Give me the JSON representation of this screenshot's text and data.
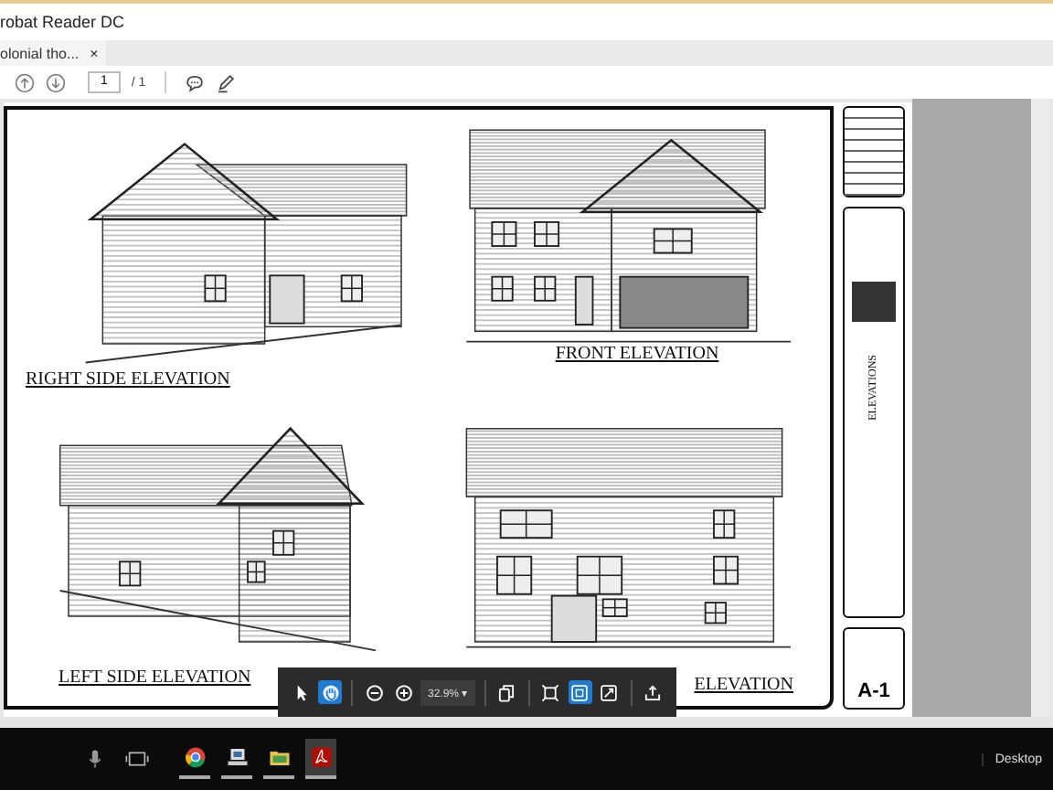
{
  "window": {
    "title": "robat Reader DC"
  },
  "tabs": [
    {
      "label": "olonial tho...",
      "close": "×",
      "selected": true
    }
  ],
  "toolbar": {
    "page": "1",
    "total": "/ 1"
  },
  "document": {
    "elevations": [
      {
        "label": "RIGHT SIDE ELEVATION"
      },
      {
        "label": "FRONT ELEVATION"
      },
      {
        "label": "LEFT SIDE ELEVATION"
      },
      {
        "label": "ELEVATION"
      }
    ],
    "title_block": {
      "sheet_title": "ELEVATIONS",
      "sheet_number": "A-1"
    }
  },
  "floating_toolbar": {
    "groups": [
      [
        {
          "kind": "select",
          "selected": false
        },
        {
          "kind": "hand",
          "selected": true
        }
      ],
      [
        {
          "kind": "zoom-out",
          "selected": false
        },
        {
          "kind": "zoom-in",
          "selected": false
        },
        {
          "kind": "zoom",
          "value": "32.9%",
          "caret": "▾",
          "selected": false
        }
      ],
      [
        {
          "kind": "pages",
          "selected": false
        }
      ],
      [
        {
          "kind": "fit-width",
          "selected": false
        },
        {
          "kind": "fit-page",
          "selected": true
        },
        {
          "kind": "full-screen",
          "selected": false
        }
      ],
      [
        {
          "kind": "share",
          "selected": false
        }
      ]
    ]
  },
  "taskbar": {
    "apps": [
      {
        "kind": "browser",
        "selected": false
      },
      {
        "kind": "computer",
        "selected": false
      },
      {
        "kind": "folder",
        "selected": false
      },
      {
        "kind": "pdf",
        "selected": true
      }
    ],
    "desktop": "Desktop"
  }
}
